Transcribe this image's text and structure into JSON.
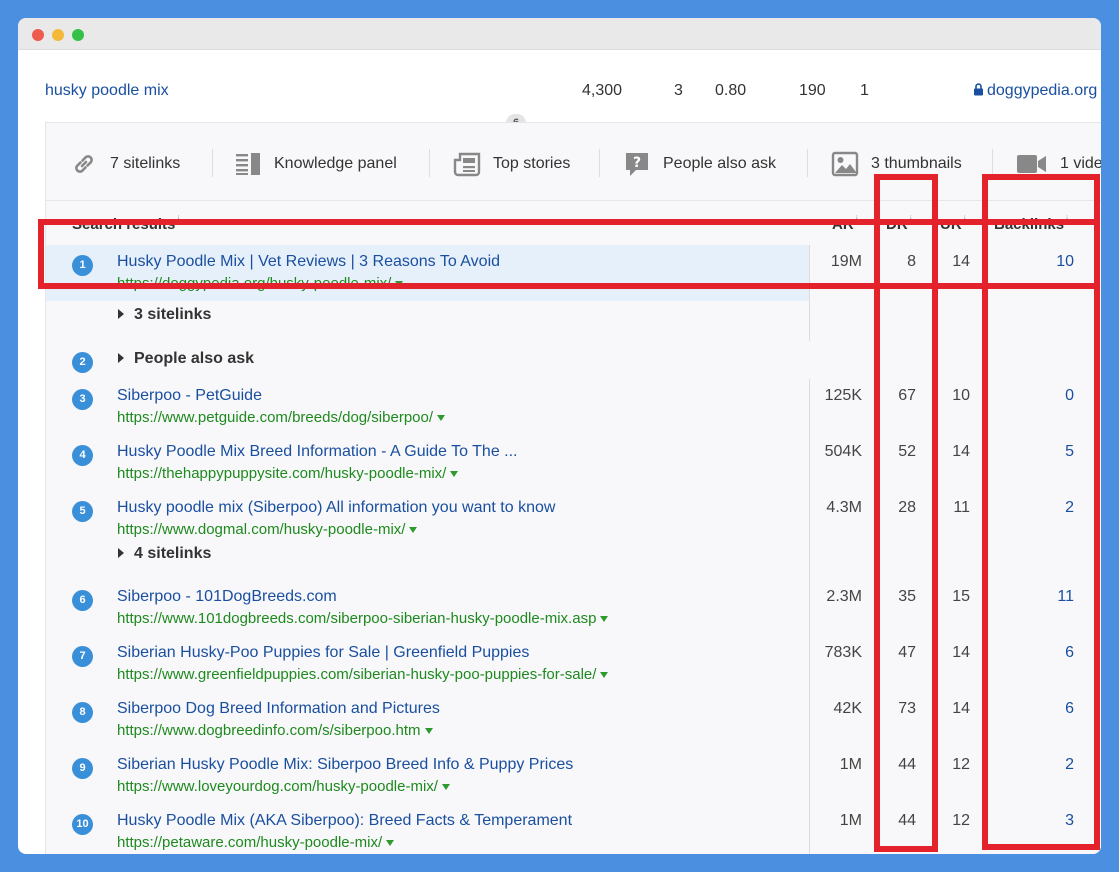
{
  "keyword_row": {
    "keyword": "husky poodle mix",
    "badge": "6",
    "volume": "4,300",
    "kd": "3",
    "cpc": "0.80",
    "traffic": "190",
    "position": "1",
    "domain": "doggypedia.org"
  },
  "features": [
    {
      "icon": "link-icon",
      "label": "7 sitelinks"
    },
    {
      "icon": "knowledge-panel-icon",
      "label": "Knowledge panel"
    },
    {
      "icon": "newspaper-icon",
      "label": "Top stories"
    },
    {
      "icon": "question-icon",
      "label": "People also ask"
    },
    {
      "icon": "image-icon",
      "label": "3 thumbnails"
    },
    {
      "icon": "video-icon",
      "label": "1 vide"
    }
  ],
  "headers": {
    "search_results": "Search results",
    "ar": "AR",
    "dr": "DR",
    "ur": "UR",
    "backlinks": "Backlinks",
    "info": "i"
  },
  "results": [
    {
      "n": "1",
      "title": "Husky Poodle Mix | Vet Reviews | 3 Reasons To Avoid",
      "url": "https://doggypedia.org/husky-poodle-mix/",
      "ar": "19M",
      "dr": "8",
      "ur": "14",
      "backlinks": "10"
    },
    {
      "n": "3",
      "title": "Siberpoo - PetGuide",
      "url": "https://www.petguide.com/breeds/dog/siberpoo/",
      "ar": "125K",
      "dr": "67",
      "ur": "10",
      "backlinks": "0"
    },
    {
      "n": "4",
      "title": "Husky Poodle Mix Breed Information - A Guide To The ...",
      "url": "https://thehappypuppysite.com/husky-poodle-mix/",
      "ar": "504K",
      "dr": "52",
      "ur": "14",
      "backlinks": "5"
    },
    {
      "n": "5",
      "title": "Husky poodle mix (Siberpoo) All information you want to know",
      "url": "https://www.dogmal.com/husky-poodle-mix/",
      "ar": "4.3M",
      "dr": "28",
      "ur": "11",
      "backlinks": "2"
    },
    {
      "n": "6",
      "title": "Siberpoo - 101DogBreeds.com",
      "url": "https://www.101dogbreeds.com/siberpoo-siberian-husky-poodle-mix.asp",
      "ar": "2.3M",
      "dr": "35",
      "ur": "15",
      "backlinks": "11"
    },
    {
      "n": "7",
      "title": "Siberian Husky-Poo Puppies for Sale | Greenfield Puppies",
      "url": "https://www.greenfieldpuppies.com/siberian-husky-poo-puppies-for-sale/",
      "ar": "783K",
      "dr": "47",
      "ur": "14",
      "backlinks": "6"
    },
    {
      "n": "8",
      "title": "Siberpoo Dog Breed Information and Pictures",
      "url": "https://www.dogbreedinfo.com/s/siberpoo.htm",
      "ar": "42K",
      "dr": "73",
      "ur": "14",
      "backlinks": "6"
    },
    {
      "n": "9",
      "title": "Siberian Husky Poodle Mix: Siberpoo Breed Info & Puppy Prices",
      "url": "https://www.loveyourdog.com/husky-poodle-mix/",
      "ar": "1M",
      "dr": "44",
      "ur": "12",
      "backlinks": "2"
    },
    {
      "n": "10",
      "title": "Husky Poodle Mix (AKA Siberpoo): Breed Facts & Temperament",
      "url": "https://petaware.com/husky-poodle-mix/",
      "ar": "1M",
      "dr": "44",
      "ur": "12",
      "backlinks": "3"
    }
  ],
  "expanders": {
    "sitelinks_1": "3 sitelinks",
    "people_also_ask_number": "2",
    "people_also_ask": "People also ask",
    "sitelinks_5": "4 sitelinks"
  },
  "colors": {
    "highlight": "#e4222b",
    "link": "#1a4fa0",
    "url": "#1e8a1e",
    "badge": "#3a8fd9",
    "background": "#4a8fe0"
  }
}
